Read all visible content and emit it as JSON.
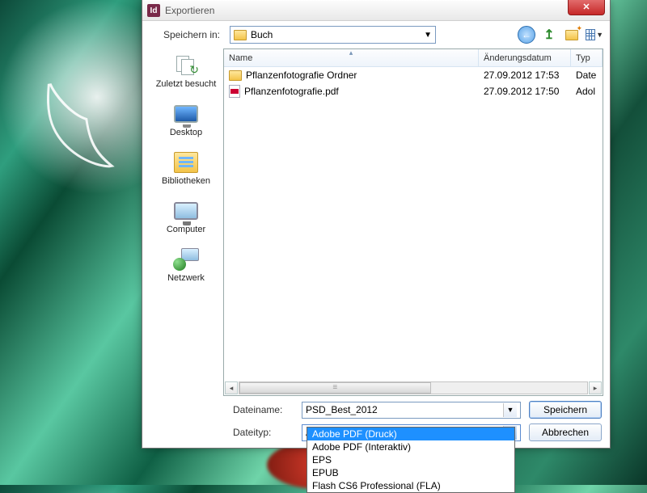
{
  "window": {
    "title": "Exportieren",
    "app_icon_text": "Id"
  },
  "toolbar": {
    "save_in_label": "Speichern in:",
    "save_in_value": "Buch",
    "nav": {
      "back": "back-icon",
      "up": "up-one-level-icon",
      "new_folder": "new-folder-icon",
      "view_menu": "view-menu-icon"
    }
  },
  "places": [
    {
      "id": "recent",
      "label": "Zuletzt besucht"
    },
    {
      "id": "desktop",
      "label": "Desktop"
    },
    {
      "id": "libraries",
      "label": "Bibliotheken"
    },
    {
      "id": "computer",
      "label": "Computer"
    },
    {
      "id": "network",
      "label": "Netzwerk"
    }
  ],
  "columns": {
    "name": "Name",
    "date": "Änderungsdatum",
    "type": "Typ"
  },
  "files": [
    {
      "icon": "folder",
      "name": "Pflanzenfotografie Ordner",
      "date": "27.09.2012 17:53",
      "type": "Date"
    },
    {
      "icon": "pdf",
      "name": "Pflanzenfotografie.pdf",
      "date": "27.09.2012 17:50",
      "type": "Adol"
    }
  ],
  "form": {
    "filename_label": "Dateiname:",
    "filename_value": "PSD_Best_2012",
    "filetype_label": "Dateityp:",
    "filetype_value": "Adobe PDF (Druck)"
  },
  "buttons": {
    "save": "Speichern",
    "cancel": "Abbrechen"
  },
  "filetype_options": [
    "Adobe PDF (Druck)",
    "Adobe PDF (Interaktiv)",
    "EPS",
    "EPUB",
    "Flash CS6 Professional (FLA)"
  ],
  "filetype_selected_index": 0
}
